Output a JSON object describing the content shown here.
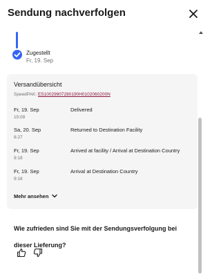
{
  "header": {
    "title": "Sendung nachverfolgen"
  },
  "timeline": {
    "status": "Zugestellt",
    "date": "Fr, 19. Sep"
  },
  "overview": {
    "title": "Versandübersicht",
    "speedpak_label": "SpeedPAK:",
    "speedpak_number": "ES10029907280190H0102060200N",
    "events": [
      {
        "date": "Fr, 19. Sep",
        "time": "15:09",
        "description": "Delivered"
      },
      {
        "date": "Sa, 20. Sep",
        "time": "8:27",
        "description": "Returned to Destination Facility"
      },
      {
        "date": "Fr, 19. Sep",
        "time": "9:18",
        "description": "Arrived at facility /  Arrival at Destination Country"
      },
      {
        "date": "Fr, 19. Sep",
        "time": "9:18",
        "description": "Arrival at Destination Country"
      }
    ],
    "more_label": "Mehr ansehen"
  },
  "feedback": {
    "question": "Wie zufrieden sind Sie mit der Sendungsverfolgung bei dieser Lieferung?"
  },
  "icons": {
    "close": "close-icon",
    "check": "checkmark-icon",
    "chevron": "chevron-down-icon",
    "thumbs_up": "thumbs-up-icon",
    "thumbs_down": "thumbs-down-icon"
  },
  "colors": {
    "accent": "#3665f3",
    "link": "#8a1538"
  }
}
